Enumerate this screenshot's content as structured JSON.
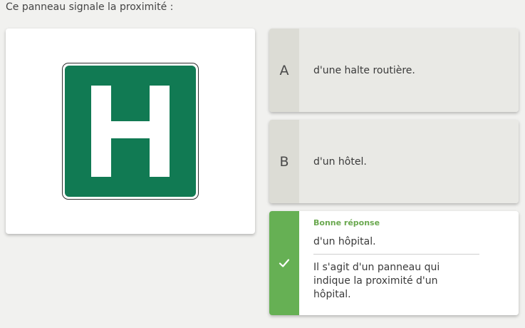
{
  "question": "Ce panneau signale la proximité :",
  "sign": {
    "letter": "H",
    "background_color": "#117a53",
    "letter_color": "#ffffff"
  },
  "options": [
    {
      "letter": "A",
      "text": "d'une halte routière."
    },
    {
      "letter": "B",
      "text": "d'un hôtel."
    },
    {
      "icon": "check-icon",
      "status_label": "Bonne réponse",
      "text": "d'un hôpital.",
      "explanation": "Il s'agit d'un panneau qui indique la proximité d'un hôpital."
    }
  ],
  "colors": {
    "correct": "#66b054",
    "option_bg": "#e9e9e5",
    "letter_bg": "#dcdcd5"
  }
}
